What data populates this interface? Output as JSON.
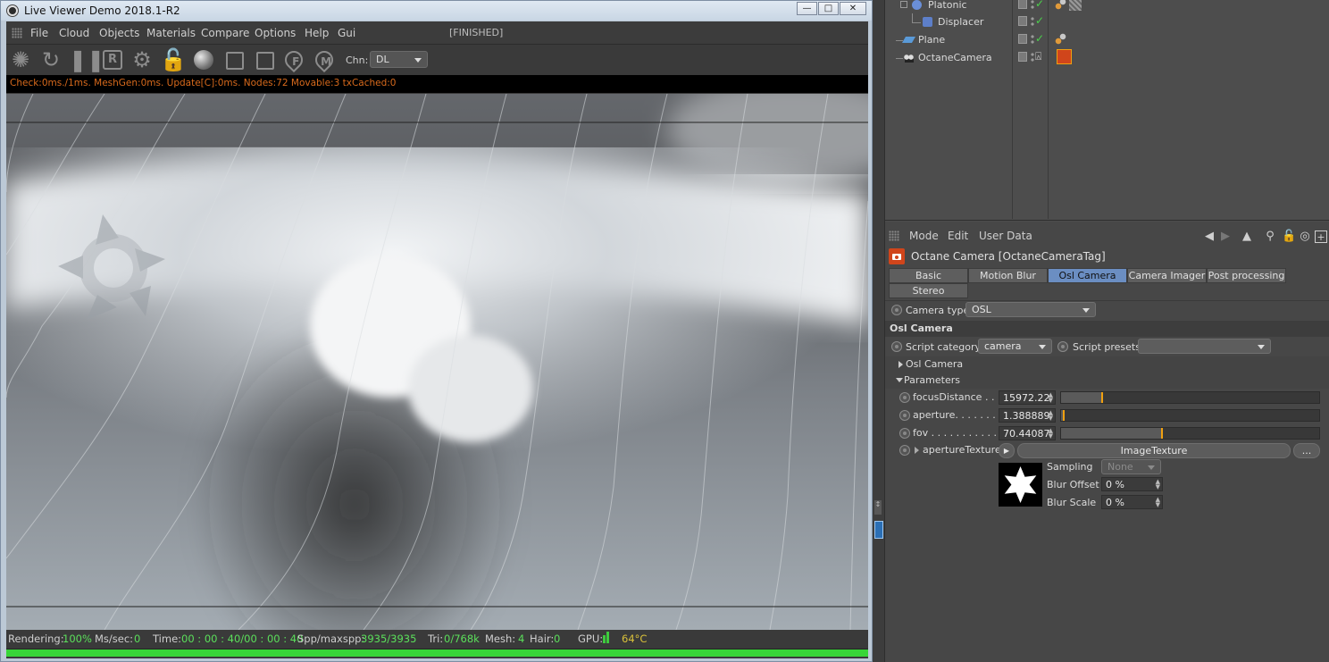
{
  "live_viewer": {
    "window_title": "Live Viewer Demo 2018.1-R2",
    "menu": [
      "File",
      "Cloud",
      "Objects",
      "Materials",
      "Compare",
      "Options",
      "Help",
      "Gui"
    ],
    "render_state": "[FINISHED]",
    "channel_label": "Chn:",
    "channel_value": "DL",
    "stats_line": "Check:0ms./1ms. MeshGen:0ms. Update[C]:0ms. Nodes:72 Movable:3 txCached:0",
    "bottom": {
      "rendering_label": "Rendering:",
      "rendering_value": "100%",
      "mssec_label": "Ms/sec:",
      "mssec_value": "0",
      "time_label": "Time:",
      "time_value": "00 : 00 : 40/00 : 00 : 40",
      "spp_label": "Spp/maxspp:",
      "spp_value": "3935/3935",
      "tri_label": "Tri:",
      "tri_value": "0/768k",
      "mesh_label": "Mesh:",
      "mesh_value": "4",
      "hair_label": "Hair:",
      "hair_value": "0",
      "gpu_label": "GPU:",
      "gpu_temp": "64°C"
    },
    "progress": 1.0
  },
  "object_manager": {
    "rows": [
      {
        "name": "Platonic"
      },
      {
        "name": "Displacer"
      },
      {
        "name": "Plane"
      },
      {
        "name": "OctaneCamera"
      }
    ]
  },
  "attributes": {
    "menu": [
      "Mode",
      "Edit",
      "User Data"
    ],
    "title": "Octane Camera [OctaneCameraTag]",
    "tabs": [
      "Basic",
      "Motion Blur",
      "Osl Camera",
      "Camera Imager",
      "Post processing",
      "Stereo"
    ],
    "active_tab": "Osl Camera",
    "camera_type_label": "Camera type",
    "camera_type_value": "OSL",
    "osl_section": "Osl Camera",
    "script_category_label": "Script category",
    "script_category_value": "camera",
    "script_presets_label": "Script presets",
    "script_presets_value": "",
    "osl_group": "Osl Camera",
    "params_group": "Parameters",
    "params": [
      {
        "label": "focusDistance . . .",
        "value": "15972.22",
        "level": 0.16
      },
      {
        "label": "aperture. . . . . . . .",
        "value": "1.388889",
        "level": 0.01
      },
      {
        "label": "fov . . . . . . . . . . .",
        "value": "70.44087",
        "level": 0.39
      }
    ],
    "aperture_texture_label": "apertureTexture",
    "aperture_texture_button": "ImageTexture",
    "more_button": "...",
    "sampling_label": "Sampling",
    "sampling_value": "None",
    "blur_offset_label": "Blur Offset",
    "blur_offset_value": "0 %",
    "blur_scale_label": "Blur Scale",
    "blur_scale_value": "0 %"
  },
  "colors": {
    "active_tab": "#6b8ec2",
    "progress": "#38d638",
    "stats_text": "#d86a1c",
    "slider_knob": "#f0a010"
  }
}
